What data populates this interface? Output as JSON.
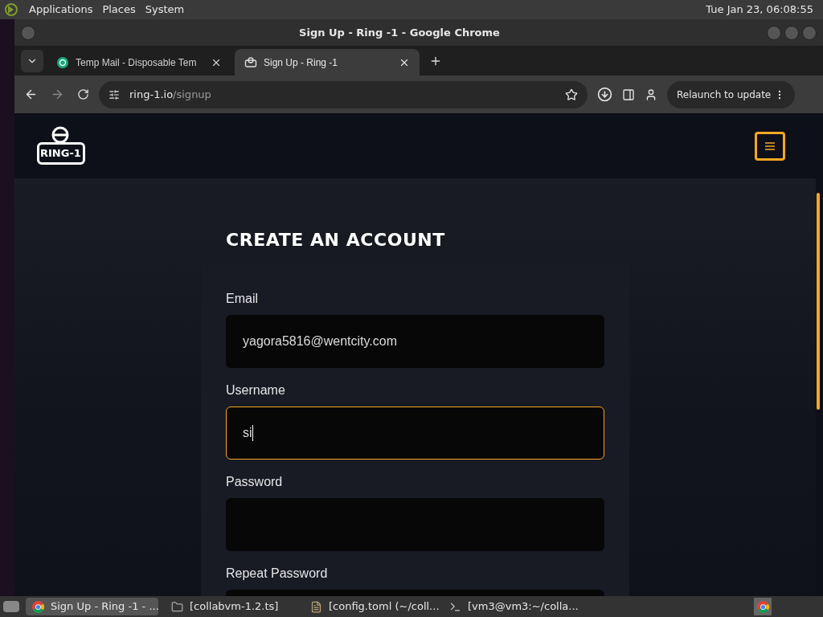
{
  "top_panel": {
    "menus": [
      "Applications",
      "Places",
      "System"
    ],
    "clock": "Tue Jan 23, 06:08:55"
  },
  "window": {
    "title": "Sign Up - Ring -1 - Google Chrome"
  },
  "tabs": [
    {
      "label": "Temp Mail - Disposable Tem",
      "selected": false
    },
    {
      "label": "Sign Up - Ring -1",
      "selected": true
    }
  ],
  "address_bar": {
    "host": "ring-1.io",
    "path": "/signup"
  },
  "relaunch_button": "Relaunch to update",
  "site": {
    "logo": "RING-1",
    "heading": "CREATE AN ACCOUNT",
    "fields": [
      {
        "label": "Email",
        "value": "yagora5816@wentcity.com",
        "focused": false
      },
      {
        "label": "Username",
        "value": "si",
        "focused": true
      },
      {
        "label": "Password",
        "focused": false
      },
      {
        "label": "Repeat Password",
        "focused": false
      }
    ]
  },
  "taskbar": [
    {
      "kind": "browser",
      "label": "Sign Up - Ring -1 - ...",
      "selected": true
    },
    {
      "kind": "folder",
      "label": "[collabvm-1.2.ts]",
      "selected": false
    },
    {
      "kind": "editor",
      "label": "[config.toml (~/coll...",
      "selected": false
    },
    {
      "kind": "terminal",
      "label": "[vm3@vm3:~/colla...",
      "selected": false
    }
  ]
}
